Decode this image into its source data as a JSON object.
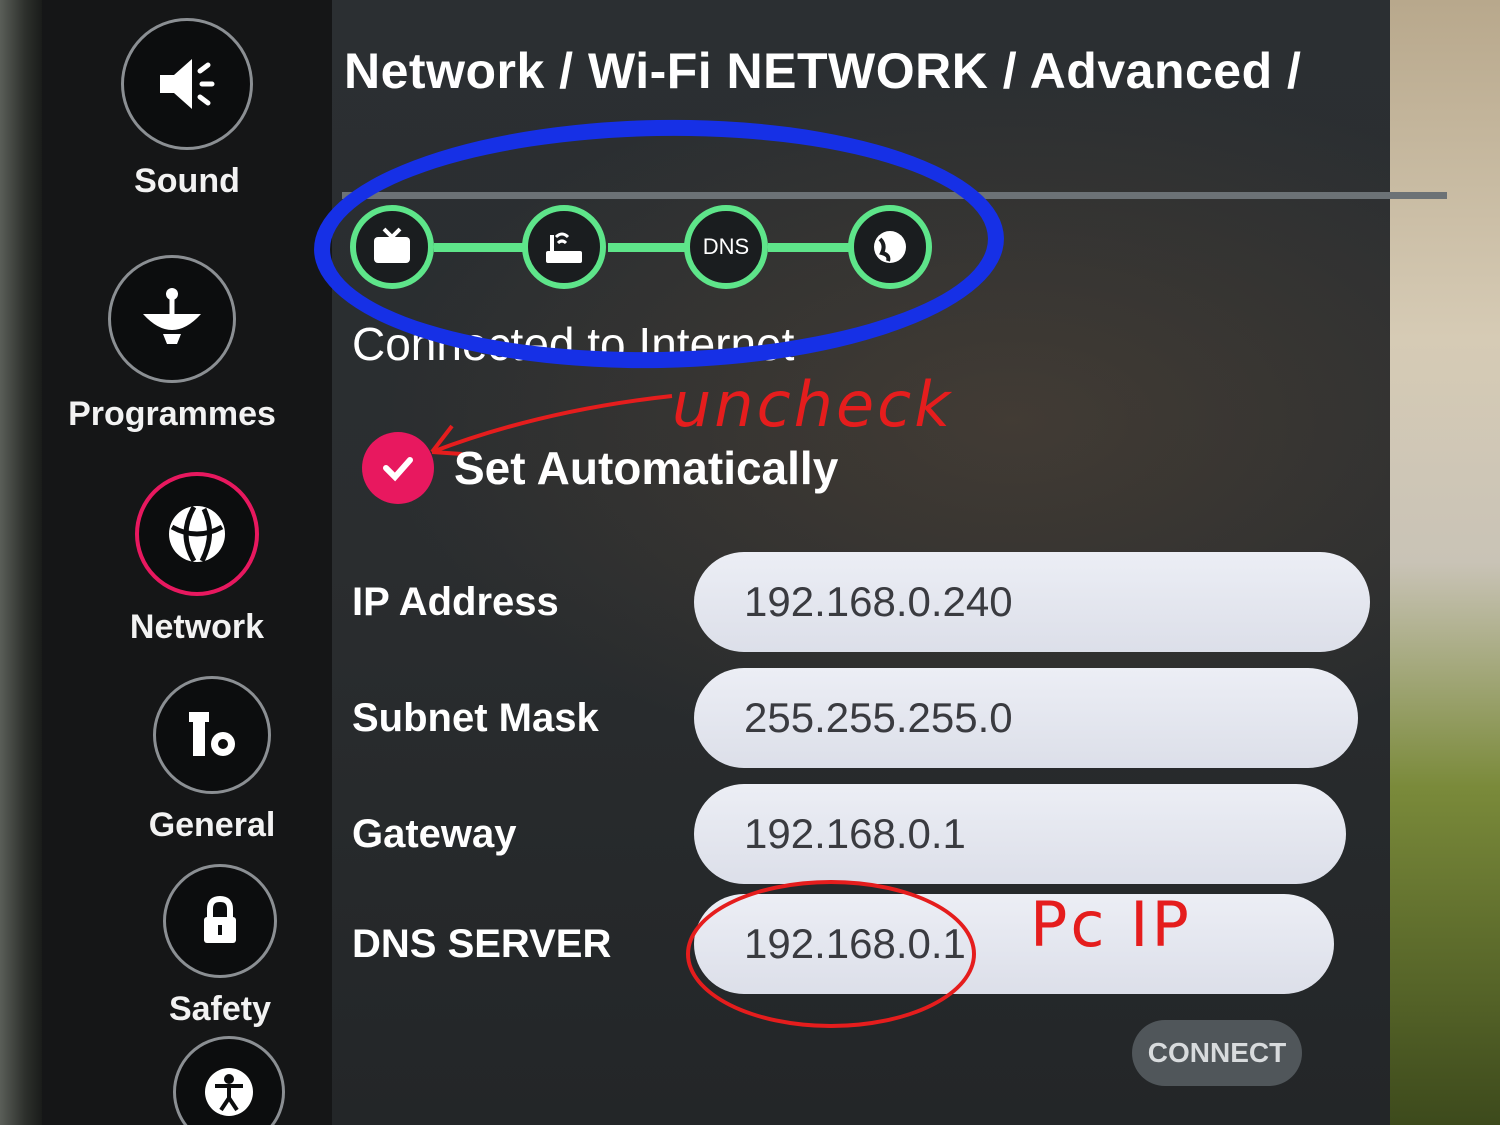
{
  "sidebar": {
    "items": [
      {
        "label": "Sound",
        "icon": "speaker-icon"
      },
      {
        "label": "Programmes",
        "icon": "satellite-dish-icon"
      },
      {
        "label": "Network",
        "icon": "globe-icon",
        "active": true
      },
      {
        "label": "General",
        "icon": "tools-icon"
      },
      {
        "label": "Safety",
        "icon": "lock-icon"
      },
      {
        "label": "",
        "icon": "accessibility-icon"
      }
    ]
  },
  "header": {
    "breadcrumb": "Network / Wi-Fi NETWORK / Advanced /"
  },
  "status": {
    "nodes": [
      "tv-icon",
      "router-icon",
      "DNS",
      "globe-icon"
    ],
    "dns_label": "DNS",
    "text": "Connected to Internet"
  },
  "settings": {
    "auto_label": "Set Automatically",
    "auto_checked": true,
    "fields": [
      {
        "label": "IP Address",
        "value": "192.168.0.240"
      },
      {
        "label": "Subnet Mask",
        "value": "255.255.255.0"
      },
      {
        "label": "Gateway",
        "value": "192.168.0.1"
      },
      {
        "label": "DNS SERVER",
        "value": "192.168.0.1"
      }
    ],
    "connect_label": "CONNECT"
  },
  "annotations": {
    "uncheck": "uncheck",
    "pc_ip": "Pc IP",
    "highlight_color": "#1630e6",
    "marker_color": "#e51d1d"
  },
  "colors": {
    "accent": "#e8185f",
    "status_green": "#5ee58a"
  }
}
